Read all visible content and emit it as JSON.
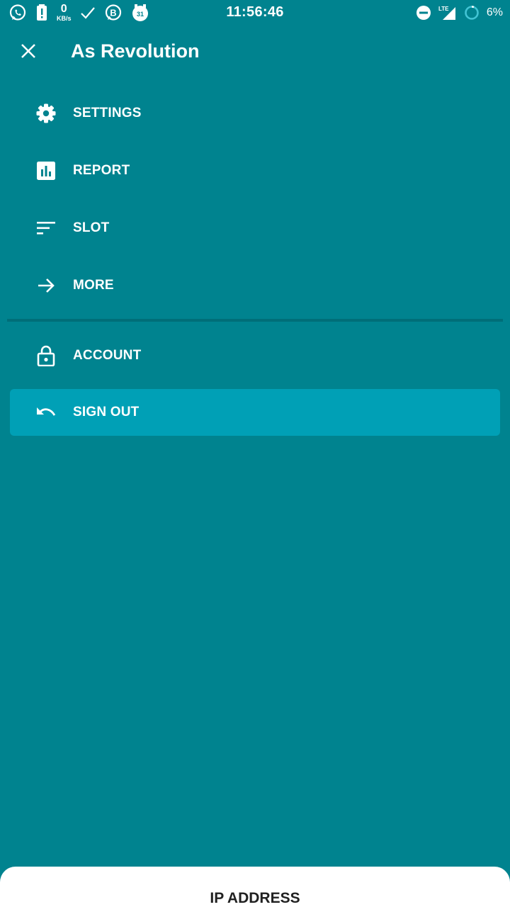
{
  "status_bar": {
    "time": "11:56:46",
    "network_speed_value": "0",
    "network_speed_unit": "KB/s",
    "network_type": "LTE",
    "battery_percent": "6%",
    "calendar_day": "31",
    "icons": [
      "whatsapp-icon",
      "alert-icon",
      "check-icon",
      "b-icon",
      "calendar-icon",
      "dnd-icon",
      "signal-icon",
      "battery-ring-icon"
    ]
  },
  "header": {
    "title": "As Revolution",
    "close_icon": "close-icon"
  },
  "menu": {
    "items": [
      {
        "label": "SETTINGS",
        "icon": "gear-icon"
      },
      {
        "label": "REPORT",
        "icon": "bar-chart-icon"
      },
      {
        "label": "SLOT",
        "icon": "sort-icon"
      },
      {
        "label": "MORE",
        "icon": "arrow-right-icon"
      },
      {
        "label": "ACCOUNT",
        "icon": "lock-icon"
      },
      {
        "label": "SIGN OUT",
        "icon": "undo-icon"
      }
    ],
    "active_item": "SIGN OUT"
  },
  "bottom_sheet": {
    "title": "IP ADDRESS"
  },
  "colors": {
    "background": "#00838f",
    "active_item": "#00a0b6",
    "divider": "#006e78",
    "sheet": "#ffffff",
    "sheet_text": "#212121"
  }
}
